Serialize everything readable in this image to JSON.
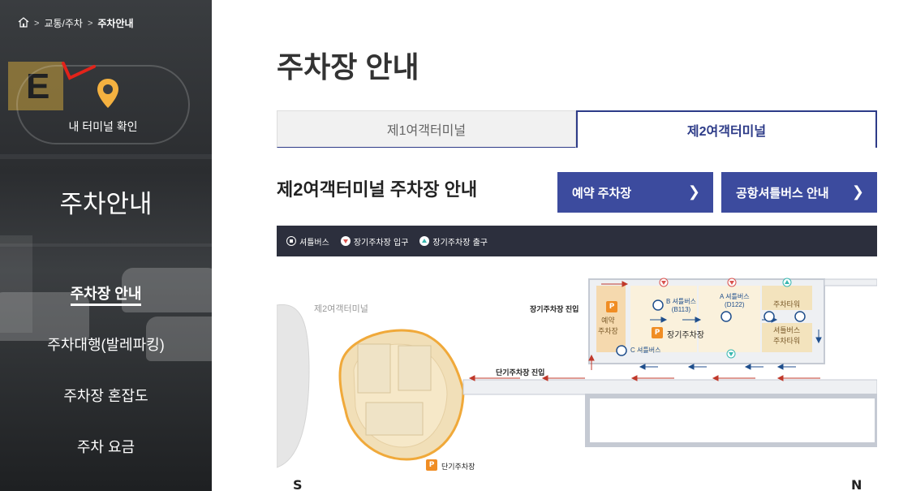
{
  "breadcrumb": {
    "home_icon": "home-icon",
    "items": [
      "교통/주차",
      "주차안내"
    ]
  },
  "terminal_check": {
    "label": "내 터미널 확인",
    "icon": "location-pin-icon"
  },
  "sidebar": {
    "title": "주차안내",
    "items": [
      {
        "label": "주차장 안내",
        "active": true
      },
      {
        "label": "주차대행(발레파킹)",
        "active": false
      },
      {
        "label": "주차장 혼잡도",
        "active": false
      },
      {
        "label": "주차 요금",
        "active": false
      }
    ]
  },
  "main": {
    "page_title": "주차장 안내",
    "tabs": [
      {
        "label": "제1여객터미널",
        "active": false
      },
      {
        "label": "제2여객터미널",
        "active": true
      }
    ],
    "section_title": "제2여객터미널 주차장 안내",
    "buttons": [
      {
        "label": "예약 주차장",
        "icon": "chevron-right-icon"
      },
      {
        "label": "공항셔틀버스 안내",
        "icon": "chevron-right-icon"
      }
    ]
  },
  "map": {
    "legend": [
      "셔틀버스",
      "장기주차장 입구",
      "장기주차장 출구"
    ],
    "labels": {
      "terminal": "제2여객터미널",
      "long_term_entry": "장기주차장 진입",
      "short_term_entry": "단기주차장 진입",
      "reserved": "예약\n주차장",
      "long_term": "장기주차장",
      "short_term": "단기주차장",
      "bus_b": "B 셔틀버스\n(B113)",
      "bus_a": "A 셔틀버스\n(D122)",
      "bus_c": "C 셔틀버스",
      "tower1": "주차타워",
      "tower2": "셔틀버스\n주차타워",
      "p_symbol": "P"
    },
    "compass": {
      "south": "S",
      "north": "N"
    },
    "colors": {
      "legend_bg": "#2c2f3d",
      "parking": "#f3e3bd",
      "terminal": "#e8c98a",
      "arrow": "#c0392b"
    }
  }
}
